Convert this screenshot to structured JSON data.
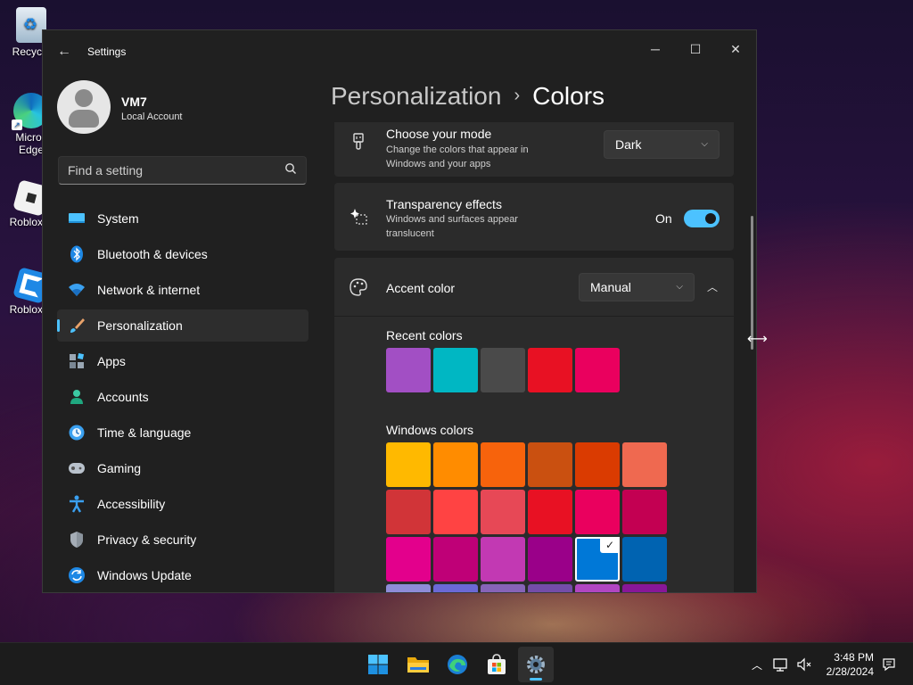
{
  "desktop": {
    "icons": [
      {
        "label": "Recycle",
        "icon": "recycle-bin-icon"
      },
      {
        "label": "Micros Edge",
        "icon": "edge-icon"
      },
      {
        "label": "Roblox P",
        "icon": "roblox-icon"
      },
      {
        "label": "Roblox S",
        "icon": "roblox-studio-icon"
      }
    ]
  },
  "window": {
    "title": "Settings",
    "controls": {
      "minimize": "─",
      "maximize": "☐",
      "close": "✕"
    }
  },
  "profile": {
    "name": "VM7",
    "account_type": "Local Account"
  },
  "search": {
    "placeholder": "Find a setting"
  },
  "sidebar": {
    "items": [
      {
        "label": "System",
        "icon": "system-icon",
        "active": false
      },
      {
        "label": "Bluetooth & devices",
        "icon": "bluetooth-icon",
        "active": false
      },
      {
        "label": "Network & internet",
        "icon": "network-icon",
        "active": false
      },
      {
        "label": "Personalization",
        "icon": "personalization-brush-icon",
        "active": true
      },
      {
        "label": "Apps",
        "icon": "apps-icon",
        "active": false
      },
      {
        "label": "Accounts",
        "icon": "accounts-icon",
        "active": false
      },
      {
        "label": "Time & language",
        "icon": "time-language-icon",
        "active": false
      },
      {
        "label": "Gaming",
        "icon": "gaming-icon",
        "active": false
      },
      {
        "label": "Accessibility",
        "icon": "accessibility-icon",
        "active": false
      },
      {
        "label": "Privacy & security",
        "icon": "shield-icon",
        "active": false
      },
      {
        "label": "Windows Update",
        "icon": "windows-update-icon",
        "active": false
      }
    ]
  },
  "breadcrumb": {
    "parent": "Personalization",
    "separator": "›",
    "current": "Colors"
  },
  "mode_card": {
    "title": "Choose your mode",
    "description": "Change the colors that appear in Windows and your apps",
    "value": "Dark",
    "icon": "brush-icon"
  },
  "transparency_card": {
    "title": "Transparency effects",
    "description": "Windows and surfaces appear translucent",
    "state_label": "On",
    "enabled": true,
    "icon": "sparkle-icon"
  },
  "accent_card": {
    "title": "Accent color",
    "value": "Manual",
    "icon": "palette-icon",
    "recent_label": "Recent colors",
    "recent_colors": [
      "#a24fc4",
      "#00b7c3",
      "#4a4a4a",
      "#e81123",
      "#ea005e"
    ],
    "windows_label": "Windows colors",
    "windows_colors": [
      "#ffb900",
      "#ff8c00",
      "#f7630c",
      "#ca5010",
      "#da3b01",
      "#ef6950",
      "#d13438",
      "#ff4343",
      "#e74856",
      "#e81123",
      "#ea005e",
      "#c30052",
      "#e3008c",
      "#bf0077",
      "#c239b3",
      "#9a0089",
      "#0078d7",
      "#0063b1",
      "#8e8cd8",
      "#6b69d6",
      "#8764b8",
      "#744da9",
      "#b146c2",
      "#881798"
    ],
    "selected_color": "#0078d7"
  },
  "taskbar": {
    "apps": [
      {
        "name": "start-button",
        "icon": "windows-logo-icon",
        "active": false
      },
      {
        "name": "file-explorer-button",
        "icon": "folder-icon",
        "active": false
      },
      {
        "name": "edge-button",
        "icon": "edge-icon",
        "active": false
      },
      {
        "name": "store-button",
        "icon": "store-icon",
        "active": false
      },
      {
        "name": "settings-button",
        "icon": "gear-icon",
        "active": true
      }
    ],
    "time": "3:48 PM",
    "date": "2/28/2024"
  }
}
